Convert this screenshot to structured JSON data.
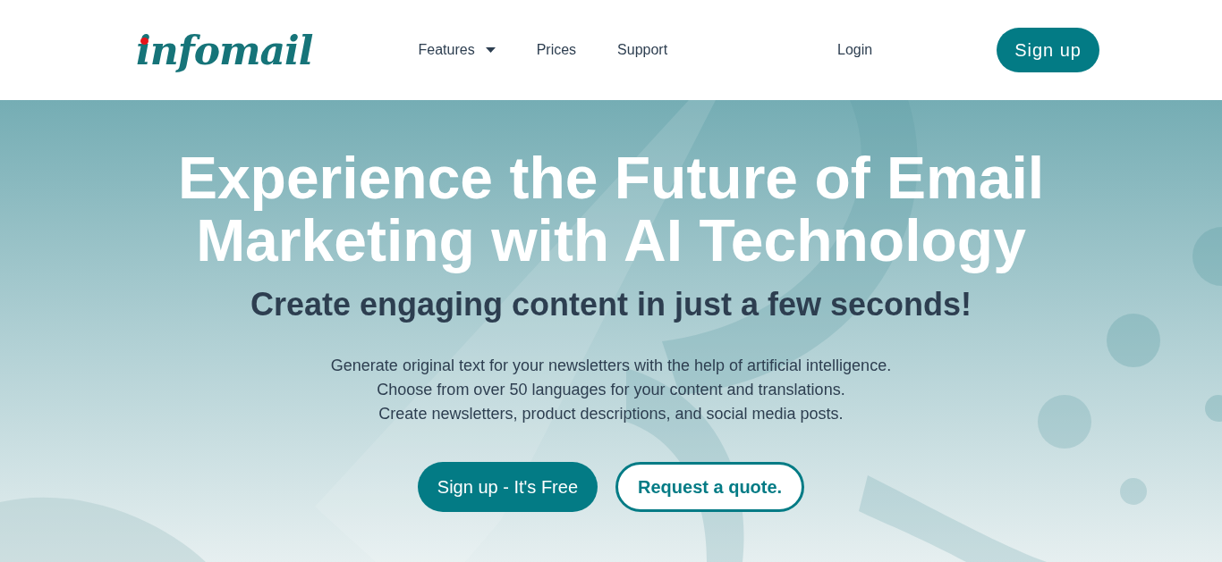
{
  "header": {
    "logo": "infomail",
    "nav": [
      {
        "label": "Features",
        "dropdown": true
      },
      {
        "label": "Prices",
        "dropdown": false
      },
      {
        "label": "Support",
        "dropdown": false
      }
    ],
    "login": "Login",
    "signup": "Sign up"
  },
  "hero": {
    "title": "Experience the Future of Email Marketing with AI Technology",
    "subtitle": "Create engaging content in just a few seconds!",
    "lines": [
      "Generate original text for your newsletters with the help of artificial intelligence.",
      "Choose from over 50 languages for your content and translations.",
      "Create newsletters, product descriptions, and social media posts."
    ],
    "buttons": [
      {
        "label": "Sign up - It's Free",
        "kind": "primary"
      },
      {
        "label": "Request a quote.",
        "kind": "outline"
      }
    ]
  }
}
